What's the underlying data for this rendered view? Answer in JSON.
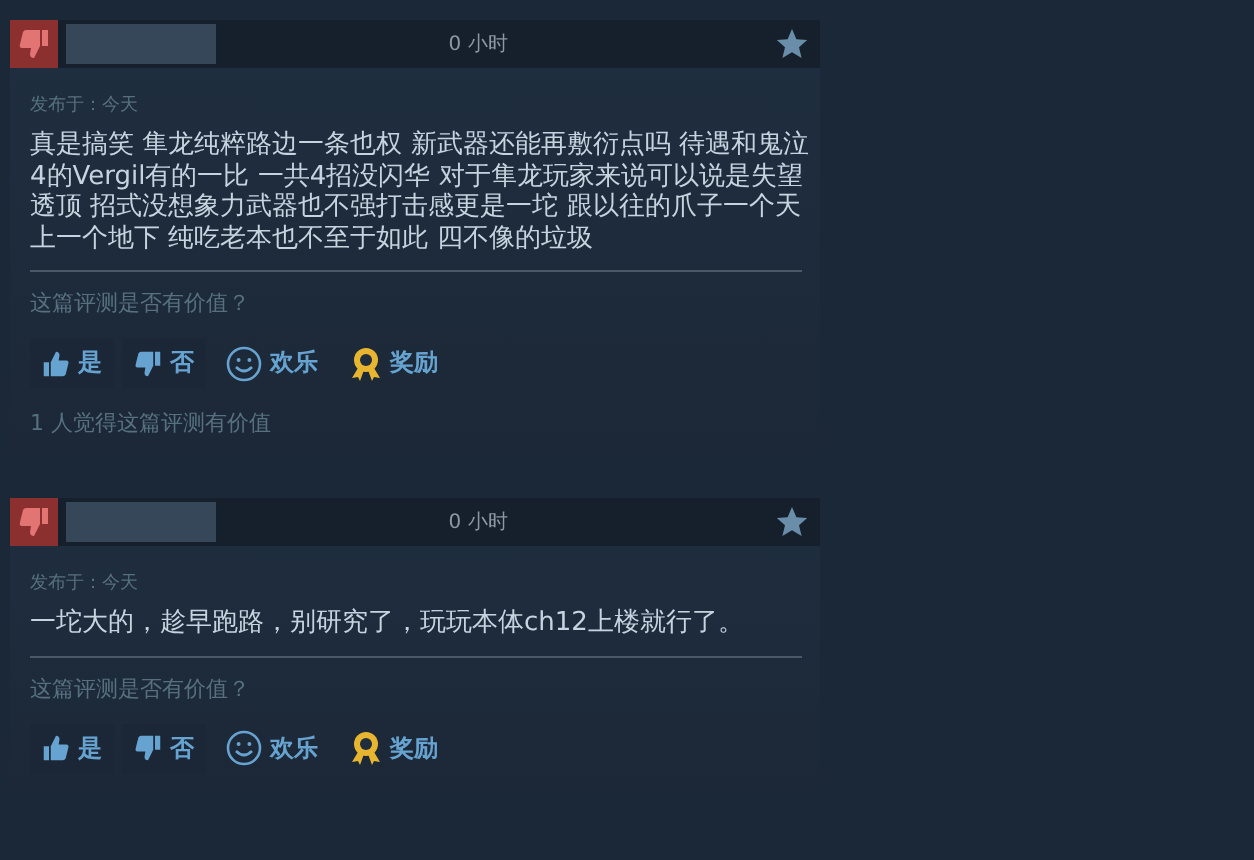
{
  "reviews": [
    {
      "recommended": false,
      "hours": "0 小时",
      "posted": "发布于：今天",
      "text": "真是搞笑 隼龙纯粹路边一条也权 新武器还能再敷衍点吗 待遇和鬼泣4的Vergil有的一比 一共4招没闪华 对于隼龙玩家来说可以说是失望透顶 招式没想象力武器也不强打击感更是一坨 跟以往的爪子一个天上一个地下 纯吃老本也不至于如此 四不像的垃圾",
      "question": "这篇评测是否有价值？",
      "buttons": [
        {
          "kind": "yes",
          "label": "是"
        },
        {
          "kind": "no",
          "label": "否"
        },
        {
          "kind": "funny",
          "label": "欢乐"
        },
        {
          "kind": "award",
          "label": "奖励"
        }
      ],
      "helpful": "1 人觉得这篇评测有价值"
    },
    {
      "recommended": false,
      "hours": "0 小时",
      "posted": "发布于：今天",
      "text": "一坨大的，趁早跑路，别研究了，玩玩本体ch12上楼就行了。",
      "question": "这篇评测是否有价值？",
      "buttons": [
        {
          "kind": "yes",
          "label": "是"
        },
        {
          "kind": "no",
          "label": "否"
        },
        {
          "kind": "funny",
          "label": "欢乐"
        },
        {
          "kind": "award",
          "label": "奖励"
        }
      ]
    }
  ]
}
